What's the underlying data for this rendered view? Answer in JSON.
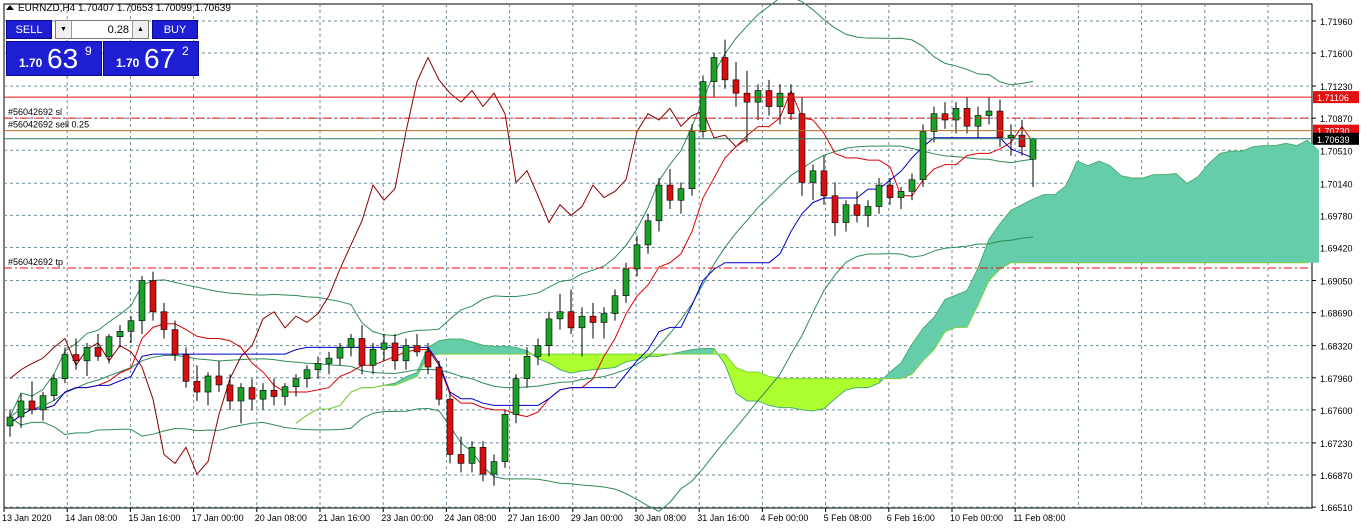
{
  "window": {
    "symbol_line": "EURNZD,H4  1.70407 1.70653 1.70099 1.70639"
  },
  "trade_panel": {
    "sell_label": "SELL",
    "buy_label": "BUY",
    "lot_value": "0.28",
    "sell_price_prefix": "1.70",
    "sell_price_big": "63",
    "sell_price_sup": "9",
    "buy_price_prefix": "1.70",
    "buy_price_big": "67",
    "buy_price_sup": "2"
  },
  "chart_data": {
    "type": "candlestick",
    "symbol": "EURNZD",
    "timeframe": "H4",
    "indicators": [
      "Ichimoku Kinko Hyo",
      "Bollinger Bands"
    ],
    "grid": true,
    "ylim": [
      1.665,
      1.7215
    ],
    "y_ticks": [
      "1.71960",
      "1.71600",
      "1.71230",
      "1.70870",
      "1.70510",
      "1.70140",
      "1.69780",
      "1.69420",
      "1.69050",
      "1.68690",
      "1.68320",
      "1.67960",
      "1.67600",
      "1.67230",
      "1.66870",
      "1.66510"
    ],
    "x_ticks": [
      "13 Jan 2020",
      "14 Jan 08:00",
      "15 Jan 16:00",
      "17 Jan 00:00",
      "20 Jan 08:00",
      "21 Jan 16:00",
      "23 Jan 00:00",
      "24 Jan 08:00",
      "27 Jan 16:00",
      "29 Jan 00:00",
      "30 Jan 08:00",
      "31 Jan 16:00",
      "4 Feb 00:00",
      "5 Feb 08:00",
      "6 Feb 16:00",
      "10 Feb 00:00",
      "11 Feb 08:00"
    ],
    "order_lines": [
      {
        "label": "#56042692 sl",
        "price": 1.7087,
        "color": "#e01010",
        "style": "dashdot"
      },
      {
        "label": "#56042692 sell 0.25",
        "price": 1.7073,
        "color": "#b07020",
        "style": "solid"
      },
      {
        "label": "#56042692 tp",
        "price": 1.6919,
        "color": "#e01010",
        "style": "dashdot"
      }
    ],
    "price_tags": [
      {
        "value": "1.71106",
        "price": 1.71106,
        "bg": "#e01010",
        "fg": "#ffffff"
      },
      {
        "value": "1.70730",
        "price": 1.7073,
        "bg": "#e01010",
        "fg": "#ffffff"
      },
      {
        "value": "1.70639",
        "price": 1.70639,
        "bg": "#000000",
        "fg": "#ffffff"
      }
    ],
    "bid_line": 1.70639,
    "resistance_line": 1.71106,
    "candles": [
      [
        1.6742,
        1.676,
        1.673,
        1.6752
      ],
      [
        1.6752,
        1.6778,
        1.674,
        1.677
      ],
      [
        1.677,
        1.6792,
        1.6755,
        1.676
      ],
      [
        1.676,
        1.678,
        1.6748,
        1.6776
      ],
      [
        1.6776,
        1.68,
        1.677,
        1.6795
      ],
      [
        1.6795,
        1.683,
        1.679,
        1.6822
      ],
      [
        1.6822,
        1.684,
        1.6805,
        1.6815
      ],
      [
        1.6815,
        1.6835,
        1.6798,
        1.683
      ],
      [
        1.683,
        1.6845,
        1.6815,
        1.682
      ],
      [
        1.682,
        1.6845,
        1.6812,
        1.6842
      ],
      [
        1.6842,
        1.6855,
        1.683,
        1.6848
      ],
      [
        1.6848,
        1.6865,
        1.6835,
        1.686
      ],
      [
        1.686,
        1.691,
        1.6845,
        1.6905
      ],
      [
        1.6905,
        1.6915,
        1.686,
        1.687
      ],
      [
        1.687,
        1.688,
        1.684,
        1.685
      ],
      [
        1.685,
        1.686,
        1.6815,
        1.6822
      ],
      [
        1.6822,
        1.683,
        1.6785,
        1.6792
      ],
      [
        1.6792,
        1.681,
        1.677,
        1.678
      ],
      [
        1.678,
        1.6802,
        1.6765,
        1.6798
      ],
      [
        1.6798,
        1.6815,
        1.678,
        1.6788
      ],
      [
        1.6788,
        1.68,
        1.676,
        1.677
      ],
      [
        1.677,
        1.679,
        1.6745,
        1.6785
      ],
      [
        1.6785,
        1.6795,
        1.676,
        1.6772
      ],
      [
        1.6772,
        1.679,
        1.676,
        1.6782
      ],
      [
        1.6782,
        1.6795,
        1.6765,
        1.6775
      ],
      [
        1.6775,
        1.679,
        1.6765,
        1.6786
      ],
      [
        1.6786,
        1.68,
        1.6775,
        1.6795
      ],
      [
        1.6795,
        1.681,
        1.6785,
        1.6805
      ],
      [
        1.6805,
        1.682,
        1.6795,
        1.6812
      ],
      [
        1.6812,
        1.6825,
        1.68,
        1.6818
      ],
      [
        1.6818,
        1.6835,
        1.681,
        1.683
      ],
      [
        1.683,
        1.6845,
        1.682,
        1.684
      ],
      [
        1.684,
        1.6855,
        1.68,
        1.681
      ],
      [
        1.681,
        1.6835,
        1.68,
        1.6828
      ],
      [
        1.6828,
        1.6845,
        1.6815,
        1.6835
      ],
      [
        1.6835,
        1.6845,
        1.6805,
        1.6815
      ],
      [
        1.6815,
        1.684,
        1.6805,
        1.6832
      ],
      [
        1.6832,
        1.6845,
        1.682,
        1.6825
      ],
      [
        1.6825,
        1.6835,
        1.68,
        1.6808
      ],
      [
        1.6808,
        1.6815,
        1.6765,
        1.6772
      ],
      [
        1.6772,
        1.678,
        1.67,
        1.671
      ],
      [
        1.671,
        1.673,
        1.669,
        1.67
      ],
      [
        1.67,
        1.6725,
        1.669,
        1.6718
      ],
      [
        1.6718,
        1.6725,
        1.668,
        1.6688
      ],
      [
        1.6688,
        1.671,
        1.6675,
        1.6702
      ],
      [
        1.6702,
        1.676,
        1.6695,
        1.6755
      ],
      [
        1.6755,
        1.68,
        1.6745,
        1.6795
      ],
      [
        1.6795,
        1.683,
        1.6785,
        1.682
      ],
      [
        1.682,
        1.684,
        1.681,
        1.6832
      ],
      [
        1.6832,
        1.687,
        1.682,
        1.6862
      ],
      [
        1.6862,
        1.689,
        1.685,
        1.687
      ],
      [
        1.687,
        1.6895,
        1.6845,
        1.6852
      ],
      [
        1.6852,
        1.6875,
        1.682,
        1.6865
      ],
      [
        1.6865,
        1.688,
        1.684,
        1.6858
      ],
      [
        1.6858,
        1.6875,
        1.684,
        1.6868
      ],
      [
        1.6868,
        1.6895,
        1.686,
        1.6888
      ],
      [
        1.6888,
        1.6925,
        1.688,
        1.6918
      ],
      [
        1.6918,
        1.6955,
        1.691,
        1.6945
      ],
      [
        1.6945,
        1.698,
        1.6935,
        1.6972
      ],
      [
        1.6972,
        1.702,
        1.696,
        1.7012
      ],
      [
        1.7012,
        1.703,
        1.6985,
        1.6995
      ],
      [
        1.6995,
        1.7015,
        1.698,
        1.7008
      ],
      [
        1.7008,
        1.708,
        1.7,
        1.7072
      ],
      [
        1.7072,
        1.7135,
        1.7065,
        1.7128
      ],
      [
        1.7128,
        1.716,
        1.711,
        1.7155
      ],
      [
        1.7155,
        1.7175,
        1.712,
        1.713
      ],
      [
        1.713,
        1.715,
        1.71,
        1.7115
      ],
      [
        1.7115,
        1.714,
        1.706,
        1.7105
      ],
      [
        1.7105,
        1.7125,
        1.7085,
        1.7118
      ],
      [
        1.7118,
        1.713,
        1.709,
        1.71
      ],
      [
        1.71,
        1.7125,
        1.708,
        1.7115
      ],
      [
        1.7115,
        1.7125,
        1.7085,
        1.7092
      ],
      [
        1.7092,
        1.711,
        1.7,
        1.7015
      ],
      [
        1.7015,
        1.7035,
        1.6995,
        1.7028
      ],
      [
        1.7028,
        1.7045,
        1.699,
        1.7
      ],
      [
        1.7,
        1.7015,
        1.6955,
        1.697
      ],
      [
        1.697,
        1.6995,
        1.696,
        1.699
      ],
      [
        1.699,
        1.7005,
        1.697,
        1.6978
      ],
      [
        1.6978,
        1.6995,
        1.6965,
        1.6988
      ],
      [
        1.6988,
        1.702,
        1.698,
        1.7012
      ],
      [
        1.7012,
        1.702,
        1.699,
        1.6998
      ],
      [
        1.6998,
        1.701,
        1.6985,
        1.7005
      ],
      [
        1.7005,
        1.7025,
        1.6995,
        1.7018
      ],
      [
        1.7018,
        1.708,
        1.701,
        1.7072
      ],
      [
        1.7072,
        1.71,
        1.706,
        1.7092
      ],
      [
        1.7092,
        1.7105,
        1.7075,
        1.7085
      ],
      [
        1.7085,
        1.7105,
        1.707,
        1.7098
      ],
      [
        1.7098,
        1.711,
        1.707,
        1.7078
      ],
      [
        1.7078,
        1.71,
        1.7065,
        1.709
      ],
      [
        1.709,
        1.711,
        1.708,
        1.7095
      ],
      [
        1.7095,
        1.7108,
        1.7055,
        1.7065
      ],
      [
        1.7065,
        1.708,
        1.7045,
        1.7068
      ],
      [
        1.7068,
        1.7085,
        1.7045,
        1.7055
      ],
      [
        1.7041,
        1.7065,
        1.701,
        1.7064
      ]
    ]
  }
}
